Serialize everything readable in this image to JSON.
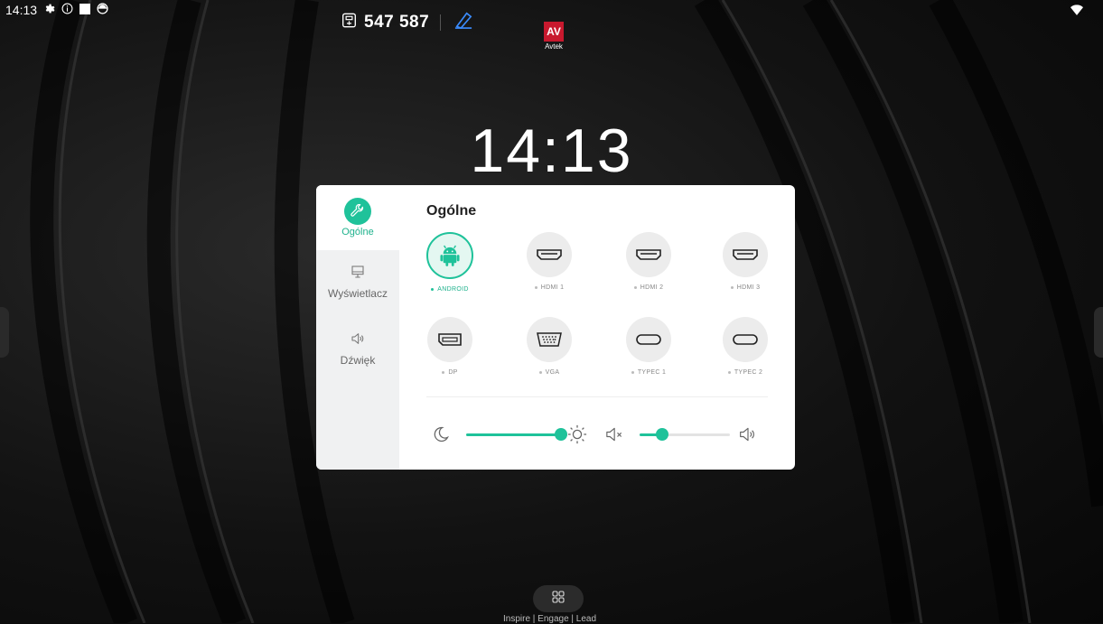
{
  "status_bar": {
    "time": "14:13",
    "icons": [
      "gear-icon",
      "info-icon",
      "square-icon",
      "camera-icon"
    ],
    "right_icons": [
      "wifi-icon"
    ]
  },
  "room": {
    "code": "547 587",
    "icon": "broadcast-icon",
    "edit_icon": "pen-icon"
  },
  "brand": {
    "logo_text": "AV",
    "name": "Avtek",
    "color": "#c8192e"
  },
  "clock": {
    "time": "14:13"
  },
  "panel": {
    "sidebar": [
      {
        "label": "Ogólne",
        "icon": "wrench-icon",
        "active": true
      },
      {
        "label": "Wyświetlacz",
        "icon": "monitor-icon",
        "active": false
      },
      {
        "label": "Dźwięk",
        "icon": "speaker-icon",
        "active": false
      }
    ],
    "title": "Ogólne",
    "sources": [
      {
        "label": "ANDROID",
        "icon": "android-icon",
        "active": true
      },
      {
        "label": "HDMI 1",
        "icon": "hdmi-icon",
        "active": false
      },
      {
        "label": "HDMI 2",
        "icon": "hdmi-icon",
        "active": false
      },
      {
        "label": "HDMI 3",
        "icon": "hdmi-icon",
        "active": false
      },
      {
        "label": "DP",
        "icon": "displayport-icon",
        "active": false
      },
      {
        "label": "VGA",
        "icon": "vga-icon",
        "active": false
      },
      {
        "label": "TYPEC 1",
        "icon": "usb-c-icon",
        "active": false
      },
      {
        "label": "TYPEC 2",
        "icon": "usb-c-icon",
        "active": false
      }
    ],
    "brightness": {
      "value": 100,
      "min_icon": "moon-icon",
      "max_icon": "sun-icon"
    },
    "volume": {
      "value": 25,
      "min_icon": "mute-icon",
      "max_icon": "volume-icon"
    }
  },
  "dock": {
    "icon": "apps-grid-icon",
    "tagline": "Inspire | Engage | Lead"
  },
  "colors": {
    "accent": "#1fc29a"
  }
}
